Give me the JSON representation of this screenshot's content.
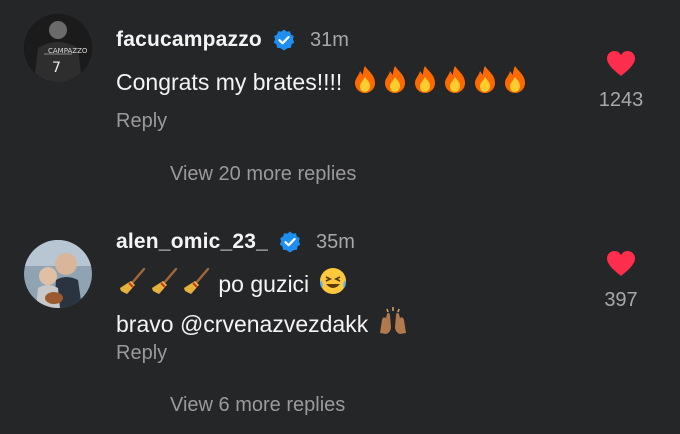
{
  "comments": [
    {
      "username": "facucampazzo",
      "time": "31m",
      "text": "Congrats my brates!!!!",
      "emojis": [
        "fire-icon",
        "fire-icon",
        "fire-icon",
        "fire-icon",
        "fire-icon",
        "fire-icon"
      ],
      "like_count": "1243",
      "reply_label": "Reply",
      "view_more": "View 20 more replies"
    },
    {
      "username": "alen_omic_23_",
      "time": "35m",
      "line1_text": "po guzici",
      "line1_emojis": [
        "broom-icon",
        "broom-icon",
        "broom-icon",
        "laughing-tears-icon"
      ],
      "line2_prefix": "bravo",
      "line2_mention": "@crvenazvezdakk",
      "line2_emoji": "raising-hands-icon",
      "like_count": "397",
      "reply_label": "Reply",
      "view_more": "View 6 more replies"
    }
  ],
  "colors": {
    "background": "#252628",
    "heart": "#ff2e4c",
    "verified": "#1f8ef1",
    "secondary_text": "#9a9a9a"
  }
}
